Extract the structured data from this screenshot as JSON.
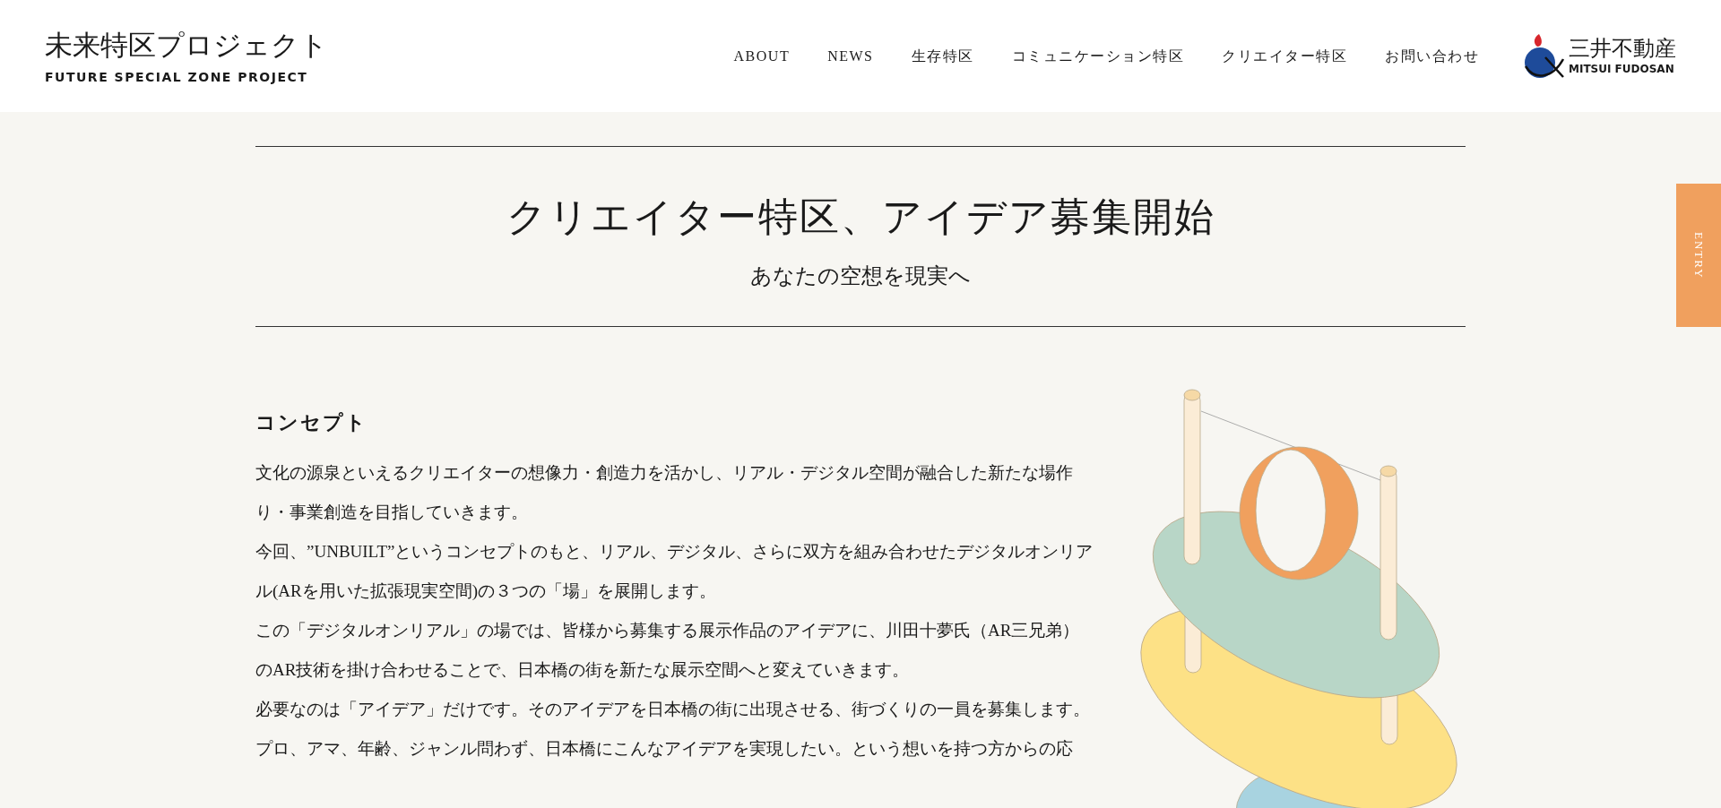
{
  "header": {
    "logo": {
      "title": "未来特区プロジェクト",
      "subtitle": "FUTURE SPECIAL ZONE PROJECT"
    },
    "nav": [
      "ABOUT",
      "NEWS",
      "生存特区",
      "コミュニケーション特区",
      "クリエイター特区",
      "お問い合わせ"
    ],
    "company": {
      "name": "三井不動産",
      "romaji": "MITSUI FUDOSAN"
    }
  },
  "entry_tab": "ENTRY",
  "hero": {
    "title": "クリエイター特区、アイデア募集開始",
    "subtitle": "あなたの空想を現実へ"
  },
  "concept": {
    "heading": "コンセプト",
    "paragraphs": [
      "文化の源泉といえるクリエイターの想像力・創造力を活かし、リアル・デジタル空間が融合した新たな場作り・事業創造を目指していきます。",
      "今回、”UNBUILT”というコンセプトのもと、リアル、デジタル、さらに双方を組み合わせたデジタルオンリアル(ARを用いた拡張現実空間)の３つの「場」を展開します。",
      "この「デジタルオンリアル」の場では、皆様から募集する展示作品のアイデアに、川田十夢氏（AR三兄弟）のAR技術を掛け合わせることで、日本橋の街を新たな展示空間へと変えていきます。",
      "必要なのは「アイデア」だけです。そのアイデアを日本橋の街に出現させる、街づくりの一員を募集します。",
      "プロ、アマ、年齢、ジャンル問わず、日本橋にこんなアイデアを実現したい。という想いを持つ方からの応"
    ]
  }
}
